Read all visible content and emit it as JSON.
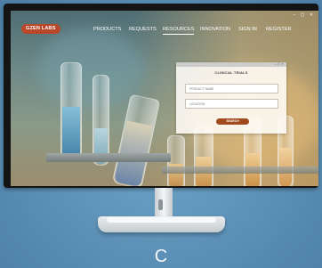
{
  "app": {
    "logo": "GZEN LABS",
    "window_controls": "– ▢ ✕"
  },
  "nav": {
    "items": [
      {
        "label": "PRODUCTS",
        "active": false
      },
      {
        "label": "REQUESTS",
        "active": false
      },
      {
        "label": "RESOURCES",
        "active": true
      },
      {
        "label": "INNOVATION",
        "active": false
      },
      {
        "label": "SIGN IN",
        "active": false
      },
      {
        "label": "REGISTER",
        "active": false
      }
    ]
  },
  "panel": {
    "title": "CLINICAL TRIALS",
    "product_placeholder": "PRODUCT NAME",
    "location_placeholder": "LOCATION",
    "search_label": "SEARCH"
  },
  "caption": "C",
  "colors": {
    "background": "#5b8fb5",
    "logo": "#b9472a",
    "search_button": "#a04a1e"
  }
}
